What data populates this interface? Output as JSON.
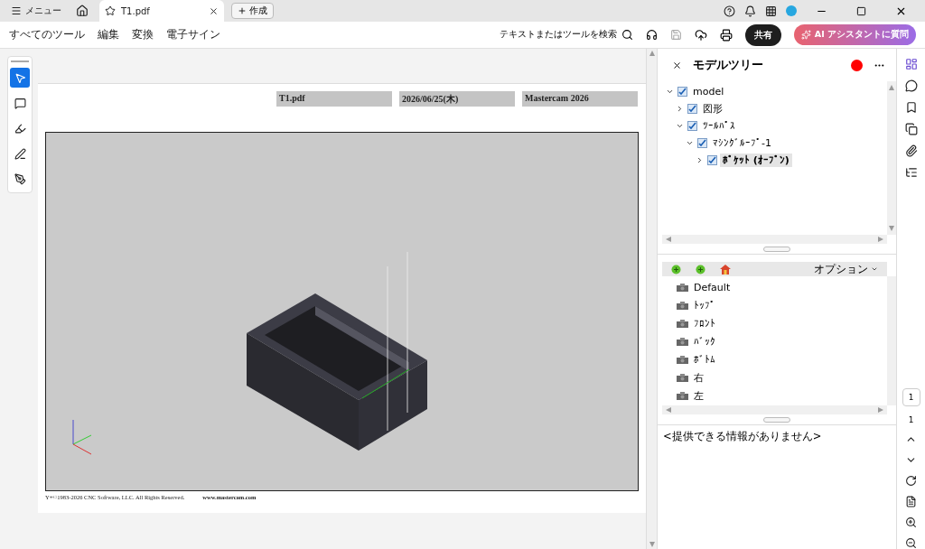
{
  "titlebar": {
    "menu_label": "メニュー",
    "tabs": [
      {
        "label": "T1.pdf",
        "selected": true
      }
    ],
    "new_button": "作成"
  },
  "menubar": {
    "items": [
      "すべてのツール",
      "編集",
      "変換",
      "電子サイン"
    ],
    "search": "テキストまたはツールを検索",
    "share": "共有",
    "ai": "AI アシスタントに質問"
  },
  "tools": [
    {
      "kind": "select",
      "selected": true
    },
    {
      "kind": "comment",
      "selected": false
    },
    {
      "kind": "highlight",
      "selected": false
    },
    {
      "kind": "draw",
      "selected": false
    },
    {
      "kind": "sign",
      "selected": false
    }
  ],
  "document": {
    "header": [
      "T1.pdf",
      "2026/06/25(木)",
      "Mastercam 2026"
    ],
    "footer": [
      "Y+©1983-2026 CNC Software, LLC. All Rights Reserved.",
      "www.mastercam.com"
    ]
  },
  "model_tree": {
    "title": "モデルツリー",
    "tree": [
      {
        "label": "model",
        "expanded": true,
        "checked": true,
        "selected": false,
        "children": [
          {
            "label": "図形",
            "expanded": false,
            "checked": true,
            "selected": false
          },
          {
            "label": "ﾂｰﾙﾊﾟｽ",
            "expanded": true,
            "checked": true,
            "selected": false,
            "children": [
              {
                "label": "ﾏｼﾝｸﾞﾙｰﾌﾟ-1",
                "expanded": true,
                "checked": true,
                "selected": false,
                "children": [
                  {
                    "label": "ﾎﾟｹｯﾄ (ｵｰﾌﾟﾝ)",
                    "expanded": false,
                    "checked": true,
                    "selected": true
                  }
                ]
              }
            ]
          }
        ]
      }
    ],
    "views_options": "オプション",
    "views": [
      "Default",
      "ﾄｯﾌﾟ",
      "ﾌﾛﾝﾄ",
      "ﾊﾞｯｸ",
      "ﾎﾞﾄﾑ",
      "右",
      "左"
    ],
    "info": "<提供できる情報がありません>"
  },
  "page_nav": {
    "current": "1",
    "total": "1"
  }
}
